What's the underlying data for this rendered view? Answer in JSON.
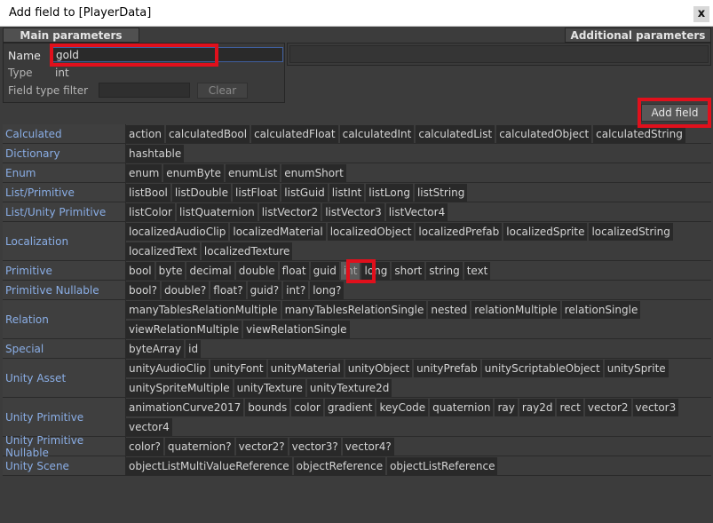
{
  "window": {
    "title": "Add field to [PlayerData]",
    "close_glyph": "x"
  },
  "tabs": {
    "main": "Main parameters",
    "additional": "Additional parameters"
  },
  "form": {
    "name_label": "Name",
    "name_value": "gold",
    "type_label": "Type",
    "type_value": "int",
    "filter_label": "Field type filter",
    "filter_value": "",
    "clear_label": "Clear"
  },
  "add_field_label": "Add field",
  "selected_type": "int",
  "categories": [
    {
      "name": "Calculated",
      "lines": [
        [
          "action",
          "calculatedBool",
          "calculatedFloat",
          "calculatedInt",
          "calculatedList",
          "calculatedObject",
          "calculatedString"
        ]
      ]
    },
    {
      "name": "Dictionary",
      "lines": [
        [
          "hashtable"
        ]
      ]
    },
    {
      "name": "Enum",
      "lines": [
        [
          "enum",
          "enumByte",
          "enumList",
          "enumShort"
        ]
      ]
    },
    {
      "name": "List/Primitive",
      "lines": [
        [
          "listBool",
          "listDouble",
          "listFloat",
          "listGuid",
          "listInt",
          "listLong",
          "listString"
        ]
      ]
    },
    {
      "name": "List/Unity Primitive",
      "lines": [
        [
          "listColor",
          "listQuaternion",
          "listVector2",
          "listVector3",
          "listVector4"
        ]
      ]
    },
    {
      "name": "Localization",
      "lines": [
        [
          "localizedAudioClip",
          "localizedMaterial",
          "localizedObject",
          "localizedPrefab",
          "localizedSprite",
          "localizedString"
        ],
        [
          "localizedText",
          "localizedTexture"
        ]
      ]
    },
    {
      "name": "Primitive",
      "lines": [
        [
          "bool",
          "byte",
          "decimal",
          "double",
          "float",
          "guid",
          "int",
          "long",
          "short",
          "string",
          "text"
        ]
      ]
    },
    {
      "name": "Primitive Nullable",
      "lines": [
        [
          "bool?",
          "double?",
          "float?",
          "guid?",
          "int?",
          "long?"
        ]
      ]
    },
    {
      "name": "Relation",
      "lines": [
        [
          "manyTablesRelationMultiple",
          "manyTablesRelationSingle",
          "nested",
          "relationMultiple",
          "relationSingle"
        ],
        [
          "viewRelationMultiple",
          "viewRelationSingle"
        ]
      ]
    },
    {
      "name": "Special",
      "lines": [
        [
          "byteArray",
          "id"
        ]
      ]
    },
    {
      "name": "Unity Asset",
      "lines": [
        [
          "unityAudioClip",
          "unityFont",
          "unityMaterial",
          "unityObject",
          "unityPrefab",
          "unityScriptableObject",
          "unitySprite"
        ],
        [
          "unitySpriteMultiple",
          "unityTexture",
          "unityTexture2d"
        ]
      ]
    },
    {
      "name": "Unity Primitive",
      "lines": [
        [
          "animationCurve2017",
          "bounds",
          "color",
          "gradient",
          "keyCode",
          "quaternion",
          "ray",
          "ray2d",
          "rect",
          "vector2",
          "vector3"
        ],
        [
          "vector4"
        ]
      ]
    },
    {
      "name": "Unity Primitive Nullable",
      "lines": [
        [
          "color?",
          "quaternion?",
          "vector2?",
          "vector3?",
          "vector4?"
        ]
      ]
    },
    {
      "name": "Unity Scene",
      "lines": [
        [
          "objectListMultiValueReference",
          "objectReference",
          "objectListReference"
        ]
      ]
    }
  ]
}
